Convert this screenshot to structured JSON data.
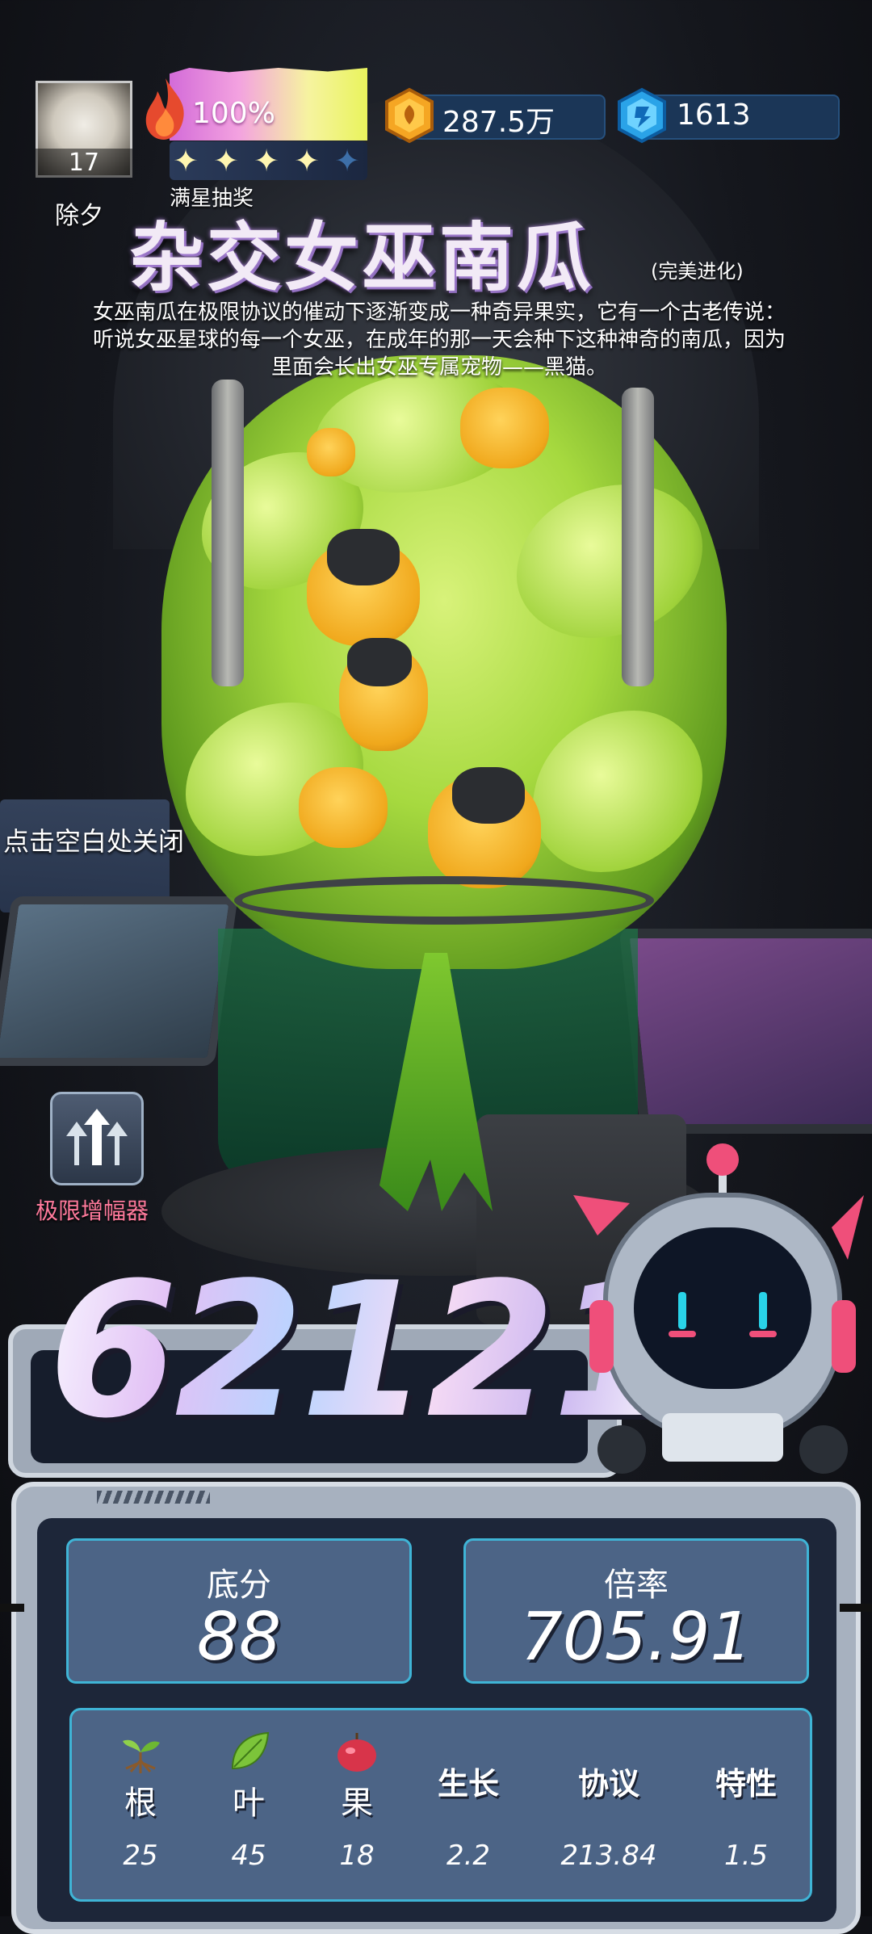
{
  "player": {
    "level": "17",
    "name": "除夕"
  },
  "energy": {
    "percent_text": "100%",
    "stars_filled": 4,
    "stars_total": 5,
    "star_label": "满星抽奖"
  },
  "currency": {
    "coins": "287.5万",
    "gems": "1613"
  },
  "plant": {
    "title": "杂交女巫南瓜",
    "tag": "(完美进化)",
    "description": "女巫南瓜在极限协议的催动下逐渐变成一种奇异果实，它有一个古老传说：听说女巫星球的每一个女巫，在成年的那一天会种下这种神奇的南瓜，因为里面会长出女巫专属宠物——黑猫。"
  },
  "hints": {
    "close": "点击空白处关闭"
  },
  "amplifier": {
    "label": "极限增幅器"
  },
  "score": {
    "total": "62121"
  },
  "stats": {
    "base_label": "底分",
    "base_value": "88",
    "rate_label": "倍率",
    "rate_value": "705.91"
  },
  "attributes": [
    {
      "name": "根",
      "value": "25",
      "icon": "sprout-icon"
    },
    {
      "name": "叶",
      "value": "45",
      "icon": "leaf-icon"
    },
    {
      "name": "果",
      "value": "18",
      "icon": "apple-icon"
    },
    {
      "name": "生长",
      "value": "2.2"
    },
    {
      "name": "协议",
      "value": "213.84"
    },
    {
      "name": "特性",
      "value": "1.5"
    }
  ],
  "colors": {
    "accent_cyan": "#3fb4d6",
    "panel_blue": "#4c6486",
    "amp_label": "#ff7a9c",
    "robot_pink": "#ef4f7a"
  }
}
